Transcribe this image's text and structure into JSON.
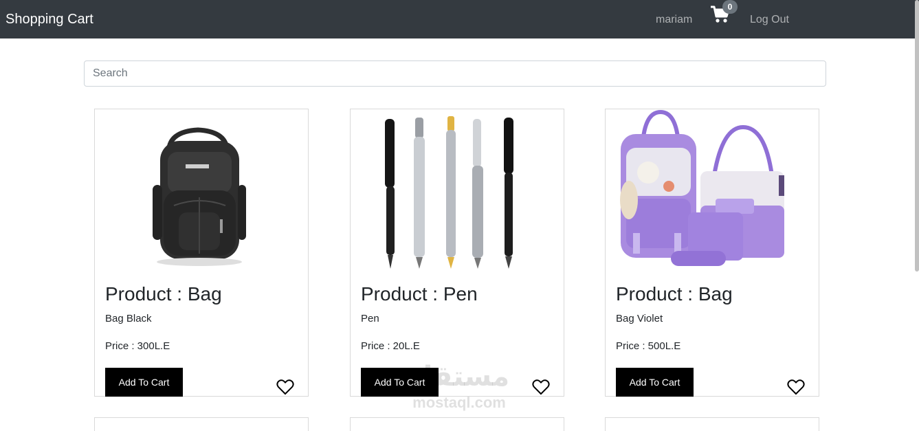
{
  "navbar": {
    "brand": "Shopping Cart",
    "user": "mariam",
    "cart_icon": "shopping-cart-icon",
    "cart_count": "0",
    "logout": "Log Out",
    "background": "#343a40"
  },
  "search": {
    "placeholder": "Search",
    "value": ""
  },
  "products": [
    {
      "title": "Product : Bag",
      "description": "Bag Black",
      "price": "Price : 300L.E",
      "button": "Add To Cart",
      "image": "black-backpack",
      "favorite_icon": "heart-outline-icon"
    },
    {
      "title": "Product : Pen",
      "description": "Pen",
      "price": "Price : 20L.E",
      "button": "Add To Cart",
      "image": "pens-set",
      "favorite_icon": "heart-outline-icon"
    },
    {
      "title": "Product : Bag",
      "description": "Bag Violet",
      "price": "Price : 500L.E",
      "button": "Add To Cart",
      "image": "violet-bag-set",
      "favorite_icon": "heart-outline-icon"
    }
  ],
  "watermark": {
    "arabic": "مستقل",
    "latin": "mostaql.com"
  },
  "colors": {
    "button": "#000000",
    "violet": "#a98be0"
  }
}
